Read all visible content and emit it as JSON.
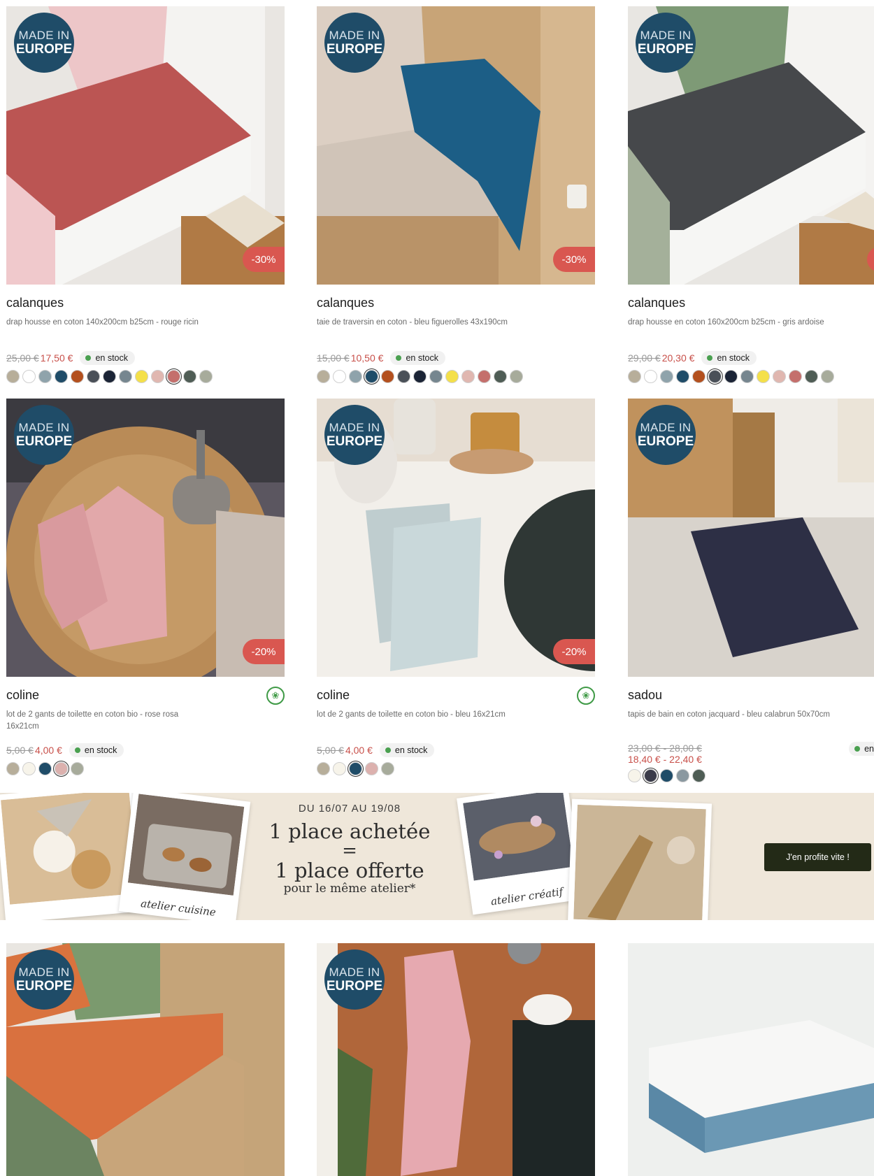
{
  "badges": {
    "made_in_line1": "MADE IN",
    "made_in_line2": "EUROPE"
  },
  "products": [
    {
      "brand": "calanques",
      "desc": "drap housse en coton 140x200cm b25cm - rouge ricin",
      "old_price": "25,00 €",
      "price": "17,50 €",
      "stock": "en stock",
      "discount": "-30%",
      "swatches": [
        "#b7ae9a",
        "#ffffff",
        "#8fa3ab",
        "#1f4c68",
        "#b3501e",
        "#4a5058",
        "#1b2436",
        "#76868f",
        "#f4e04a",
        "#e0b7b0",
        "#c46f6c",
        "#4f5d55",
        "#a7ab9b"
      ],
      "selected_swatch": 10
    },
    {
      "brand": "calanques",
      "desc": "taie de traversin en coton - bleu figuerolles 43x190cm",
      "old_price": "15,00 €",
      "price": "10,50 €",
      "stock": "en stock",
      "discount": "-30%",
      "swatches": [
        "#b7ae9a",
        "#ffffff",
        "#8fa3ab",
        "#1f4c68",
        "#b3501e",
        "#4a5058",
        "#1b2436",
        "#76868f",
        "#f4e04a",
        "#e0b7b0",
        "#c46f6c",
        "#4f5d55",
        "#a7ab9b"
      ],
      "selected_swatch": 3
    },
    {
      "brand": "calanques",
      "desc": "drap housse en coton 160x200cm b25cm - gris ardoise",
      "old_price": "29,00 €",
      "price": "20,30 €",
      "stock": "en stock",
      "discount": "",
      "swatches": [
        "#b7ae9a",
        "#ffffff",
        "#8fa3ab",
        "#1f4c68",
        "#b3501e",
        "#4a5058",
        "#1b2436",
        "#76868f",
        "#f4e04a",
        "#e0b7b0",
        "#c46f6c",
        "#4f5d55",
        "#a7ab9b"
      ],
      "selected_swatch": 5
    },
    {
      "brand": "coline",
      "desc": "lot de 2 gants de toilette en coton bio - rose rosa 16x21cm",
      "old_price": "5,00 €",
      "price": "4,00 €",
      "stock": "en stock",
      "discount": "-20%",
      "swatches": [
        "#b7ae9a",
        "#f7f4ea",
        "#1f4c68",
        "#dcb1ae",
        "#a7ab9b"
      ],
      "selected_swatch": 3
    },
    {
      "brand": "coline",
      "desc": "lot de 2 gants de toilette en coton bio - bleu 16x21cm",
      "old_price": "5,00 €",
      "price": "4,00 €",
      "stock": "en stock",
      "discount": "-20%",
      "swatches": [
        "#b7ae9a",
        "#f7f4ea",
        "#1f4c68",
        "#dcb1ae",
        "#a7ab9b"
      ],
      "selected_swatch": 2
    },
    {
      "brand": "sadou",
      "desc": "tapis de bain en coton jacquard - bleu calabrun 50x70cm",
      "old_price": "23,00 € - 28,00 €",
      "price": "18,40 € - 22,40 €",
      "stock": "en",
      "discount": "",
      "swatches": [
        "#f7f4ea",
        "#3a3b4a",
        "#1f4c68",
        "#8a98a0",
        "#4f5d55"
      ],
      "selected_swatch": 1
    }
  ],
  "banner": {
    "dates": "DU 16/07 AU 19/08",
    "line1": "1 place achetée",
    "equals": "=",
    "line2": "1 place offerte",
    "line3": "pour le même atelier*",
    "caption_left": "atelier cuisine",
    "caption_right": "atelier créatif",
    "cta": "J'en profite vite !"
  },
  "colors": {
    "badge": "#1f4c68",
    "discount": "#d95750",
    "price": "#c8504a",
    "cta": "#232a17",
    "stock_dot": "#4aa050"
  }
}
